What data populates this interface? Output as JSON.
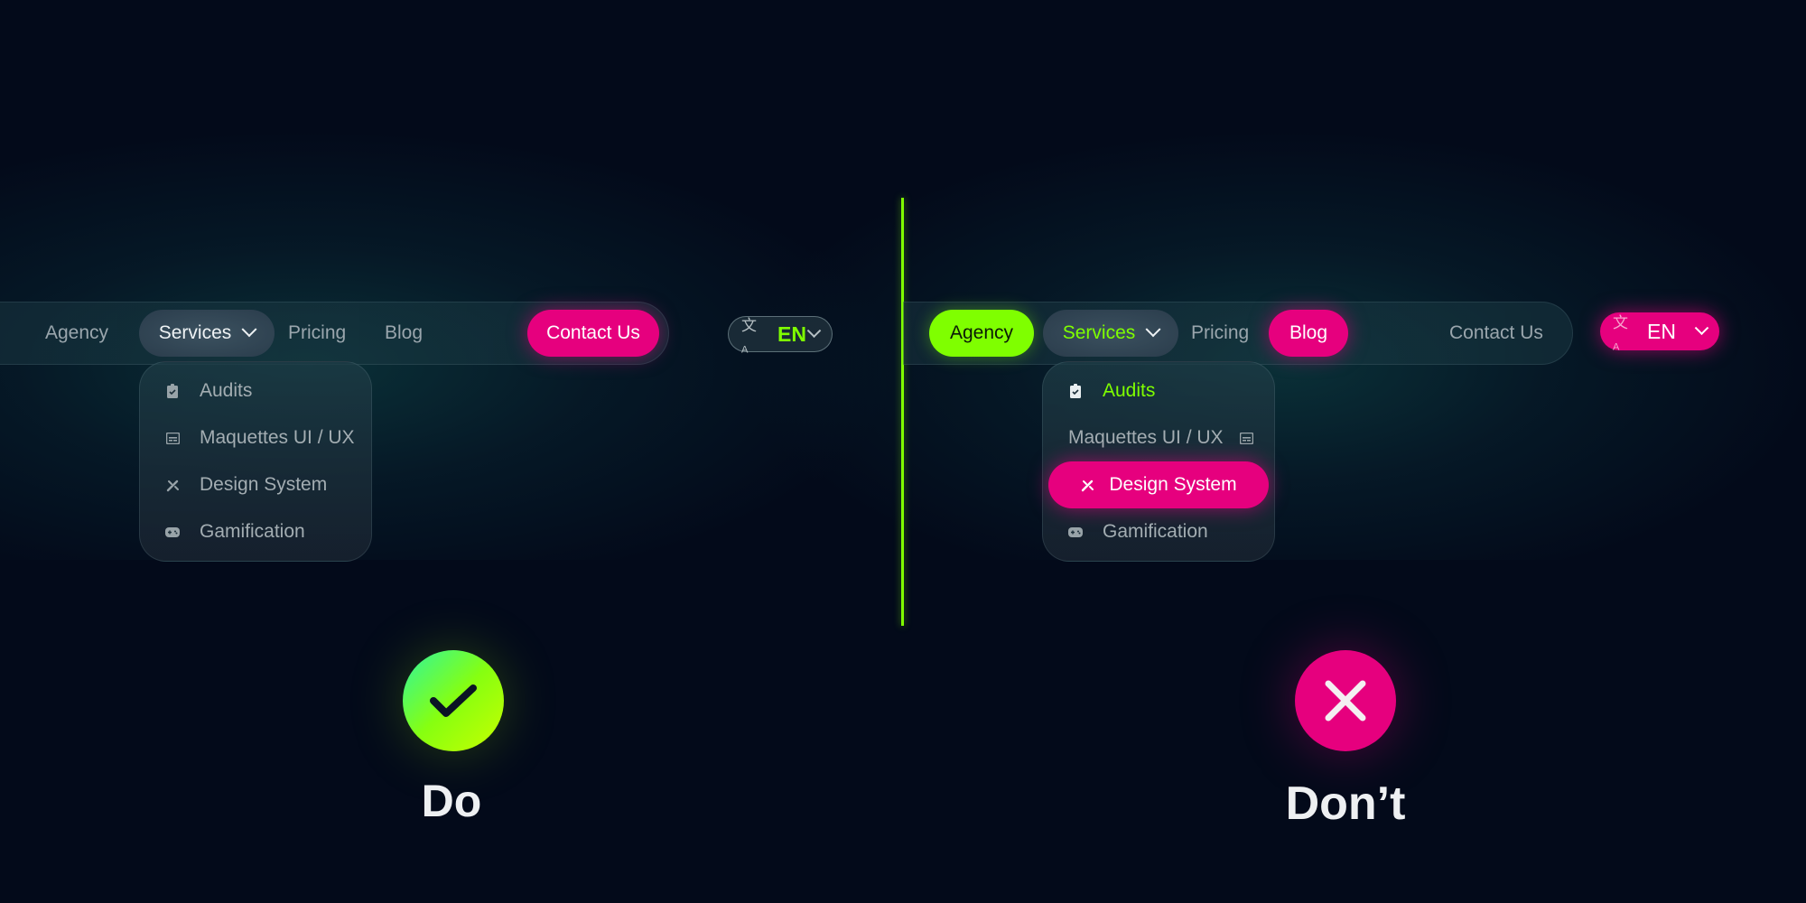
{
  "colors": {
    "background": "#030a1a",
    "accent_green": "#7fff00",
    "accent_pink": "#e6007e",
    "text_muted": "#9aa6ad",
    "text_light": "#eef2f4"
  },
  "do_example": {
    "nav": {
      "items": [
        {
          "label": "Agency"
        },
        {
          "label": "Services",
          "icon": "chevron-down-icon",
          "state": "open"
        },
        {
          "label": "Pricing"
        },
        {
          "label": "Blog"
        }
      ],
      "cta_label": "Contact Us"
    },
    "language": {
      "icon": "translate-icon",
      "code": "EN",
      "chevron": "chevron-down-icon"
    },
    "dropdown": [
      {
        "label": "Audits",
        "icon": "clipboard-check-icon"
      },
      {
        "label": "Maquettes UI / UX",
        "icon": "layout-icon"
      },
      {
        "label": "Design System",
        "icon": "design-tools-icon"
      },
      {
        "label": "Gamification",
        "icon": "gamepad-icon"
      }
    ],
    "badge_icon": "check-icon",
    "caption": "Do"
  },
  "dont_example": {
    "nav": {
      "items": [
        {
          "label": "Agency",
          "state": "highlighted-green"
        },
        {
          "label": "Services",
          "icon": "chevron-down-icon",
          "state": "open"
        },
        {
          "label": "Pricing"
        },
        {
          "label": "Blog",
          "state": "highlighted-pink"
        }
      ],
      "cta_label": "Contact Us"
    },
    "language": {
      "icon": "translate-icon",
      "code": "EN",
      "chevron": "chevron-down-icon"
    },
    "dropdown": [
      {
        "label": "Audits",
        "icon": "clipboard-check-icon",
        "state": "active-green"
      },
      {
        "label": "Maquettes UI / UX",
        "icon": "layout-icon"
      },
      {
        "label": "Design System",
        "icon": "design-tools-icon",
        "state": "highlighted-pink"
      },
      {
        "label": "Gamification",
        "icon": "gamepad-icon"
      }
    ],
    "badge_icon": "close-icon",
    "caption": "Don’t"
  }
}
